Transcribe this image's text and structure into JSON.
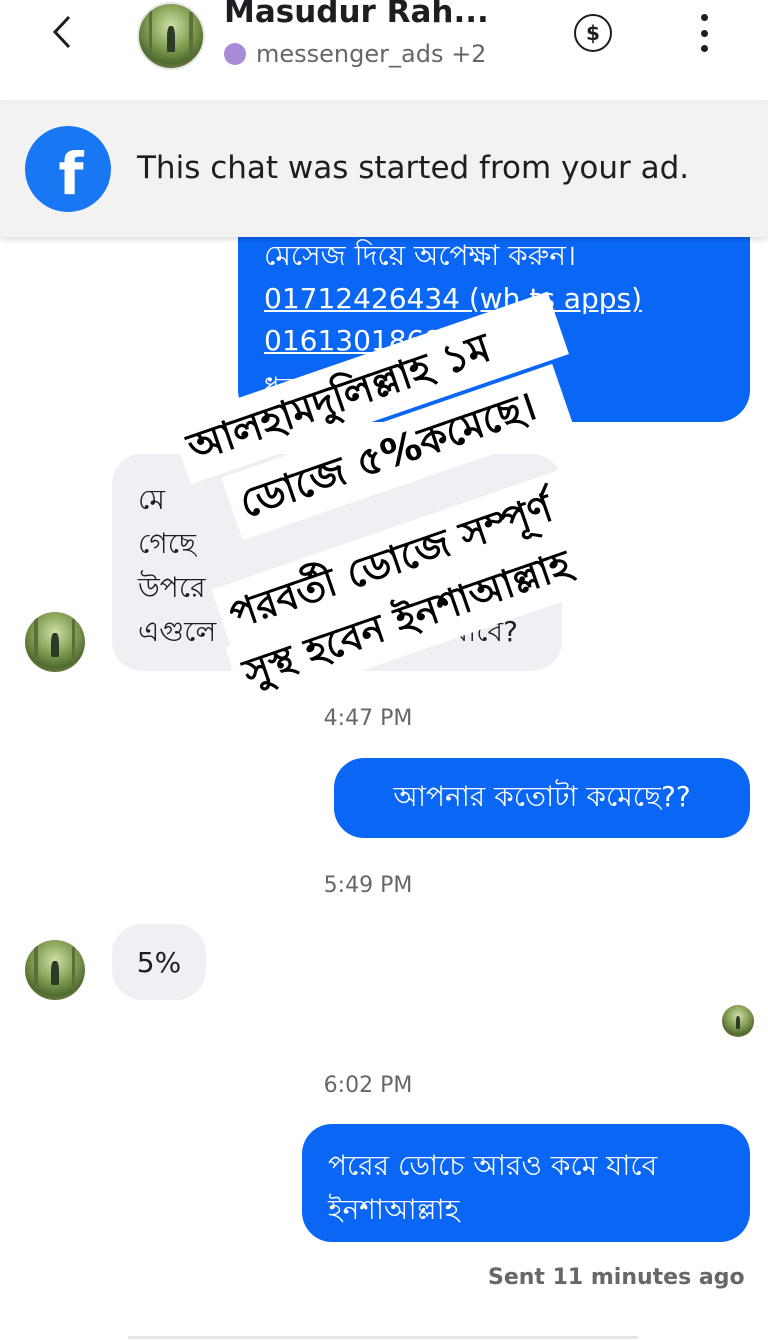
{
  "header": {
    "contact_name": "Masudur Rah...",
    "source_label": "messenger_ads +2",
    "back_icon": "chevron-left-icon",
    "payment_icon": "dollar-circle-icon",
    "more_icon": "vertical-ellipsis-icon"
  },
  "banner": {
    "text": "This chat was started from your ad.",
    "icon": "facebook-icon",
    "color": "#1877f2"
  },
  "messages": {
    "m1": {
      "line1": "মেসেজ দিয়ে অপেক্ষা করুন।",
      "line2": "01712426434 (wh",
      "line2b": "ts apps)",
      "line3": "0161301869",
      "line4": "ধন্যবাদ"
    },
    "m2": {
      "line1": "মে",
      "line2": "গেছে",
      "line3": "উপরে",
      "line4": "এগুলে",
      "line4b": "যাবে?"
    },
    "time1": "4:47 PM",
    "m3": "আপনার কতোটা কমেছে??",
    "time2": "5:49 PM",
    "m4": "5%",
    "time3": "6:02 PM",
    "m5": {
      "line1": "পরের ডোচে আরও কমে যাবে",
      "line2": "ইনশাআল্লাহ"
    },
    "status": "Sent 11 minutes ago"
  },
  "overlay": {
    "line1": "আলহামদুলিল্লাহ ১ম",
    "line2": "ডোজে ৫%কমেছে।",
    "line3": "পরবর্তী ডোজে সম্পূর্ণ",
    "line4": "সুস্থ হবেন ইনশাআল্লাহ"
  },
  "colors": {
    "outgoing_bubble": "#0a66f5",
    "incoming_bubble": "#f0f0f4",
    "source_dot": "#a78bd6"
  }
}
